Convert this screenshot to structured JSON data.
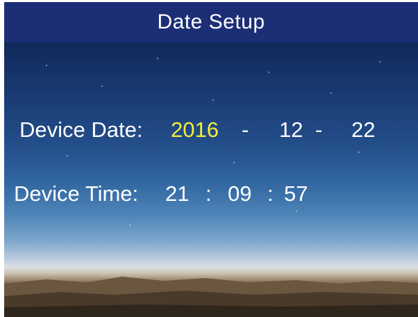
{
  "header": {
    "title": "Date Setup"
  },
  "date_row": {
    "label": "Device Date:",
    "year": "2016",
    "separator1": "-",
    "month": "12",
    "separator2": "-",
    "day": "22"
  },
  "time_row": {
    "label": "Device Time:",
    "hour": "21",
    "separator1": ":",
    "minute": "09",
    "separator2": ":",
    "second": "57"
  },
  "colors": {
    "title_bar": "#1c2f76",
    "text": "#ffffff",
    "selected_field": "#f4ee3a"
  }
}
